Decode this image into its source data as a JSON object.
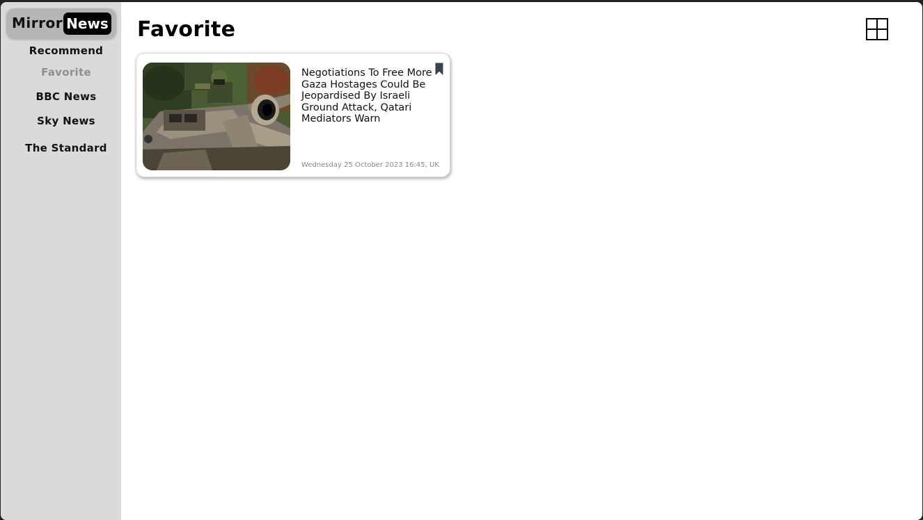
{
  "logo": {
    "part1": "Mirror",
    "part2": "News"
  },
  "sidebar": {
    "items": [
      {
        "label": "Recommend"
      },
      {
        "label": "Favorite"
      },
      {
        "label": "BBC News"
      },
      {
        "label": "Sky News"
      },
      {
        "label": "The Standard"
      }
    ],
    "active": "Favorite"
  },
  "page": {
    "title": "Favorite"
  },
  "articles": [
    {
      "title": "Negotiations To Free More Gaza Hostages Could Be Jeopardised By Israeli Ground Attack, Qatari Mediators Warn",
      "date": "Wednesday 25 October 2023 16:45, UK",
      "bookmarked": true,
      "image": "soldier-in-tank-photo"
    }
  ],
  "icons": {
    "grid": "grid-view-icon",
    "bookmark": "bookmark-icon"
  },
  "colors": {
    "sidebar_bg": "#dadada",
    "active_nav": "#8e8e8e",
    "bookmark": "#3a4150"
  }
}
